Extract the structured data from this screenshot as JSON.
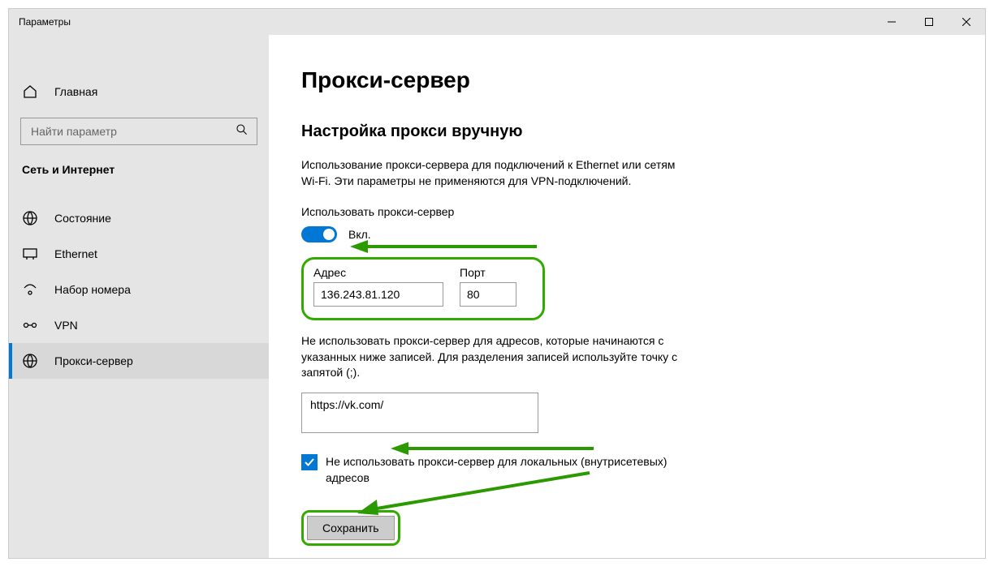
{
  "window": {
    "title": "Параметры"
  },
  "sidebar": {
    "home": "Главная",
    "search_placeholder": "Найти параметр",
    "category": "Сеть и Интернет",
    "items": [
      {
        "label": "Состояние"
      },
      {
        "label": "Ethernet"
      },
      {
        "label": "Набор номера"
      },
      {
        "label": "VPN"
      },
      {
        "label": "Прокси-сервер"
      }
    ]
  },
  "page": {
    "title": "Прокси-сервер",
    "section_title": "Настройка прокси вручную",
    "description": "Использование прокси-сервера для подключений к Ethernet или сетям Wi-Fi. Эти параметры не применяются для VPN-подключений.",
    "use_proxy_label": "Использовать прокси-сервер",
    "toggle_state_label": "Вкл.",
    "address_label": "Адрес",
    "address_value": "136.243.81.120",
    "port_label": "Порт",
    "port_value": "80",
    "exceptions_hint": "Не использовать прокси-сервер для адресов, которые начинаются с указанных ниже записей. Для разделения записей используйте точку с запятой (;).",
    "exceptions_value": "https://vk.com/",
    "bypass_local_label": "Не использовать прокси-сервер для локальных (внутрисетевых) адресов",
    "bypass_local_checked": true,
    "save_button": "Сохранить"
  },
  "annotation_color": "#2a9a00"
}
